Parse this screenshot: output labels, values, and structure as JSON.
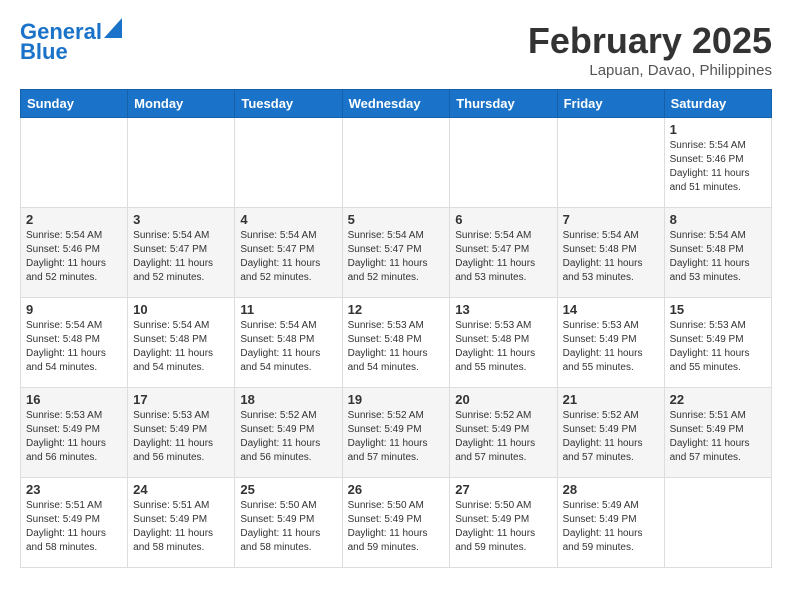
{
  "logo": {
    "line1": "General",
    "line2": "Blue"
  },
  "title": "February 2025",
  "location": "Lapuan, Davao, Philippines",
  "headers": [
    "Sunday",
    "Monday",
    "Tuesday",
    "Wednesday",
    "Thursday",
    "Friday",
    "Saturday"
  ],
  "weeks": [
    [
      {
        "day": "",
        "info": ""
      },
      {
        "day": "",
        "info": ""
      },
      {
        "day": "",
        "info": ""
      },
      {
        "day": "",
        "info": ""
      },
      {
        "day": "",
        "info": ""
      },
      {
        "day": "",
        "info": ""
      },
      {
        "day": "1",
        "info": "Sunrise: 5:54 AM\nSunset: 5:46 PM\nDaylight: 11 hours\nand 51 minutes."
      }
    ],
    [
      {
        "day": "2",
        "info": "Sunrise: 5:54 AM\nSunset: 5:46 PM\nDaylight: 11 hours\nand 52 minutes."
      },
      {
        "day": "3",
        "info": "Sunrise: 5:54 AM\nSunset: 5:47 PM\nDaylight: 11 hours\nand 52 minutes."
      },
      {
        "day": "4",
        "info": "Sunrise: 5:54 AM\nSunset: 5:47 PM\nDaylight: 11 hours\nand 52 minutes."
      },
      {
        "day": "5",
        "info": "Sunrise: 5:54 AM\nSunset: 5:47 PM\nDaylight: 11 hours\nand 52 minutes."
      },
      {
        "day": "6",
        "info": "Sunrise: 5:54 AM\nSunset: 5:47 PM\nDaylight: 11 hours\nand 53 minutes."
      },
      {
        "day": "7",
        "info": "Sunrise: 5:54 AM\nSunset: 5:48 PM\nDaylight: 11 hours\nand 53 minutes."
      },
      {
        "day": "8",
        "info": "Sunrise: 5:54 AM\nSunset: 5:48 PM\nDaylight: 11 hours\nand 53 minutes."
      }
    ],
    [
      {
        "day": "9",
        "info": "Sunrise: 5:54 AM\nSunset: 5:48 PM\nDaylight: 11 hours\nand 54 minutes."
      },
      {
        "day": "10",
        "info": "Sunrise: 5:54 AM\nSunset: 5:48 PM\nDaylight: 11 hours\nand 54 minutes."
      },
      {
        "day": "11",
        "info": "Sunrise: 5:54 AM\nSunset: 5:48 PM\nDaylight: 11 hours\nand 54 minutes."
      },
      {
        "day": "12",
        "info": "Sunrise: 5:53 AM\nSunset: 5:48 PM\nDaylight: 11 hours\nand 54 minutes."
      },
      {
        "day": "13",
        "info": "Sunrise: 5:53 AM\nSunset: 5:48 PM\nDaylight: 11 hours\nand 55 minutes."
      },
      {
        "day": "14",
        "info": "Sunrise: 5:53 AM\nSunset: 5:49 PM\nDaylight: 11 hours\nand 55 minutes."
      },
      {
        "day": "15",
        "info": "Sunrise: 5:53 AM\nSunset: 5:49 PM\nDaylight: 11 hours\nand 55 minutes."
      }
    ],
    [
      {
        "day": "16",
        "info": "Sunrise: 5:53 AM\nSunset: 5:49 PM\nDaylight: 11 hours\nand 56 minutes."
      },
      {
        "day": "17",
        "info": "Sunrise: 5:53 AM\nSunset: 5:49 PM\nDaylight: 11 hours\nand 56 minutes."
      },
      {
        "day": "18",
        "info": "Sunrise: 5:52 AM\nSunset: 5:49 PM\nDaylight: 11 hours\nand 56 minutes."
      },
      {
        "day": "19",
        "info": "Sunrise: 5:52 AM\nSunset: 5:49 PM\nDaylight: 11 hours\nand 57 minutes."
      },
      {
        "day": "20",
        "info": "Sunrise: 5:52 AM\nSunset: 5:49 PM\nDaylight: 11 hours\nand 57 minutes."
      },
      {
        "day": "21",
        "info": "Sunrise: 5:52 AM\nSunset: 5:49 PM\nDaylight: 11 hours\nand 57 minutes."
      },
      {
        "day": "22",
        "info": "Sunrise: 5:51 AM\nSunset: 5:49 PM\nDaylight: 11 hours\nand 57 minutes."
      }
    ],
    [
      {
        "day": "23",
        "info": "Sunrise: 5:51 AM\nSunset: 5:49 PM\nDaylight: 11 hours\nand 58 minutes."
      },
      {
        "day": "24",
        "info": "Sunrise: 5:51 AM\nSunset: 5:49 PM\nDaylight: 11 hours\nand 58 minutes."
      },
      {
        "day": "25",
        "info": "Sunrise: 5:50 AM\nSunset: 5:49 PM\nDaylight: 11 hours\nand 58 minutes."
      },
      {
        "day": "26",
        "info": "Sunrise: 5:50 AM\nSunset: 5:49 PM\nDaylight: 11 hours\nand 59 minutes."
      },
      {
        "day": "27",
        "info": "Sunrise: 5:50 AM\nSunset: 5:49 PM\nDaylight: 11 hours\nand 59 minutes."
      },
      {
        "day": "28",
        "info": "Sunrise: 5:49 AM\nSunset: 5:49 PM\nDaylight: 11 hours\nand 59 minutes."
      },
      {
        "day": "",
        "info": ""
      }
    ]
  ]
}
